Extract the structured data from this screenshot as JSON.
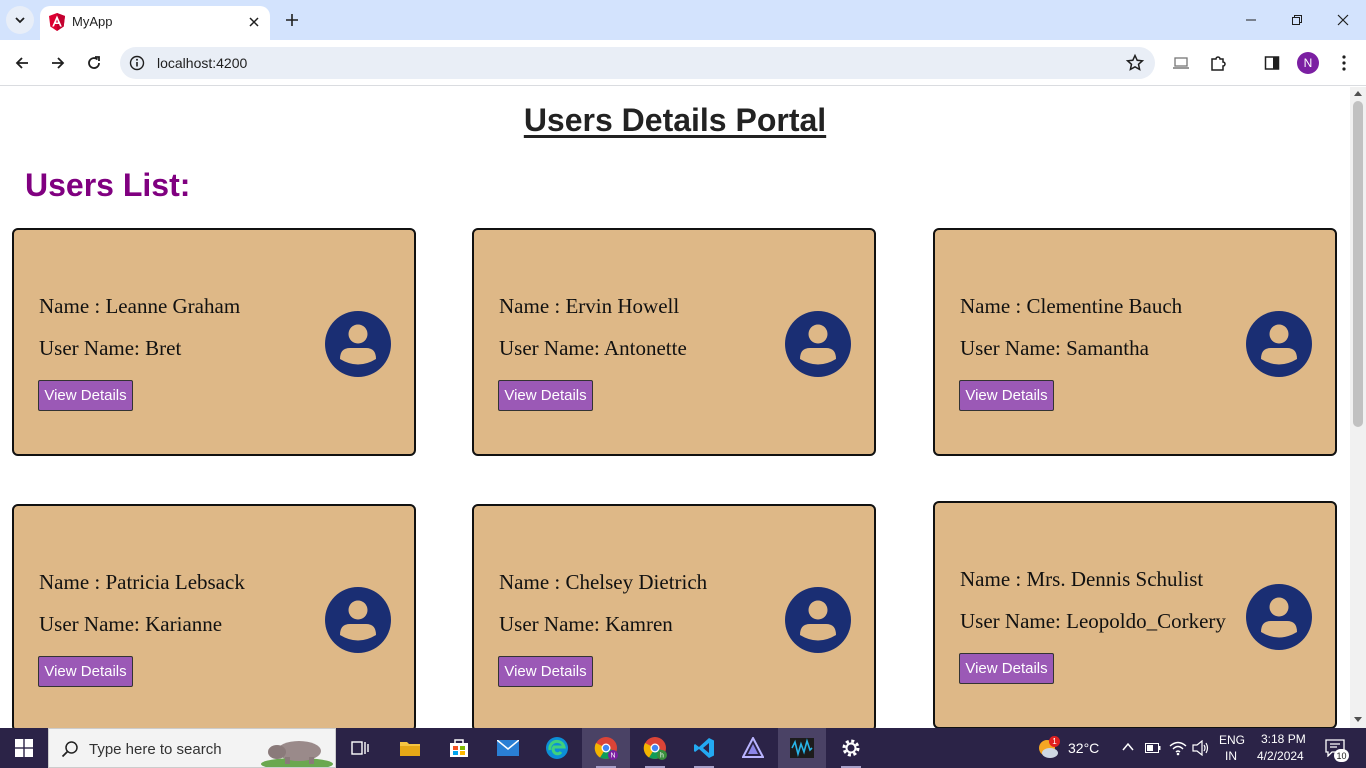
{
  "browser": {
    "tab_title": "MyApp",
    "url": "localhost:4200",
    "profile_initial": "N"
  },
  "page": {
    "title": "Users Details Portal",
    "list_heading": "Users List:",
    "users": [
      {
        "name": "Name : Leanne Graham",
        "username": "User Name: Bret",
        "button": "View Details"
      },
      {
        "name": "Name : Ervin Howell",
        "username": "User Name: Antonette",
        "button": "View Details"
      },
      {
        "name": "Name : Clementine Bauch",
        "username": "User Name: Samantha",
        "button": "View Details"
      },
      {
        "name": "Name : Patricia Lebsack",
        "username": "User Name: Karianne",
        "button": "View Details"
      },
      {
        "name": "Name : Chelsey Dietrich",
        "username": "User Name: Kamren",
        "button": "View Details"
      },
      {
        "name": "Name : Mrs. Dennis Schulist",
        "username": "User Name: Leopoldo_Corkery",
        "button": "View Details"
      }
    ]
  },
  "taskbar": {
    "search_placeholder": "Type here to search",
    "weather_temp": "32°C",
    "weather_badge": "1",
    "lang_top": "ENG",
    "lang_bottom": "IN",
    "time": "3:18 PM",
    "date": "4/2/2024",
    "notification_count": "10"
  },
  "colors": {
    "card_bg": "#deb887",
    "button_bg": "#9b59b6",
    "heading_purple": "#800080",
    "avatar_navy": "#1a2e73"
  }
}
